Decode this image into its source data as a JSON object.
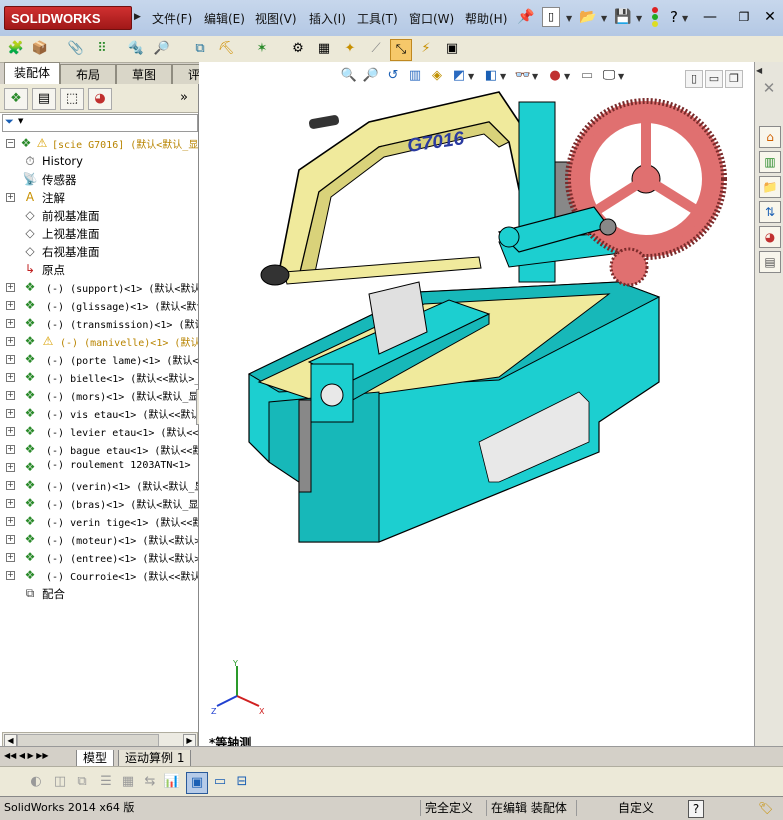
{
  "app": {
    "logo_text": "SOLIDWORKS",
    "menus": [
      "文件(F)",
      "编辑(E)",
      "视图(V)",
      "插入(I)",
      "工具(T)",
      "窗口(W)",
      "帮助(H)"
    ]
  },
  "tabs": [
    "装配体",
    "布局",
    "草图",
    "评估"
  ],
  "tree": {
    "root": "[scie G7016] (默认<默认_显",
    "items": [
      {
        "label": "History",
        "kind": "history",
        "expand": false
      },
      {
        "label": "传感器",
        "kind": "sensor",
        "expand": false
      },
      {
        "label": "注解",
        "kind": "annotation",
        "expand": true
      },
      {
        "label": "前视基准面",
        "kind": "plane",
        "expand": false
      },
      {
        "label": "上视基准面",
        "kind": "plane",
        "expand": false
      },
      {
        "label": "右视基准面",
        "kind": "plane",
        "expand": false
      },
      {
        "label": "原点",
        "kind": "origin",
        "expand": false
      },
      {
        "label": "(-) (support)<1> (默认<默认_显",
        "kind": "part",
        "expand": true
      },
      {
        "label": "(-) (glissage)<1> (默认<默认_",
        "kind": "part",
        "expand": true
      },
      {
        "label": "(-) (transmission)<1> (默认<",
        "kind": "part",
        "expand": true
      },
      {
        "label": "(-) (manivelle)<1> (默认<默",
        "kind": "part-warning",
        "expand": true
      },
      {
        "label": "(-) (porte lame)<1> (默认<默",
        "kind": "part",
        "expand": true
      },
      {
        "label": "(-) bielle<1> (默认<<默认>_显",
        "kind": "part",
        "expand": true
      },
      {
        "label": "(-) (mors)<1> (默认<默认_显",
        "kind": "part",
        "expand": true
      },
      {
        "label": "(-) vis etau<1> (默认<<默认>",
        "kind": "part",
        "expand": true
      },
      {
        "label": "(-) levier etau<1> (默认<<默",
        "kind": "part",
        "expand": true
      },
      {
        "label": "(-) bague etau<1> (默认<<默",
        "kind": "part",
        "expand": true
      },
      {
        "label": "(-) roulement 1203ATN<1>",
        "kind": "part",
        "expand": true
      },
      {
        "label": "(-) (verin)<1> (默认<默认_显",
        "kind": "part",
        "expand": true
      },
      {
        "label": "(-) (bras)<1> (默认<默认_显",
        "kind": "part",
        "expand": true
      },
      {
        "label": "(-) verin tige<1> (默认<<默",
        "kind": "part",
        "expand": true
      },
      {
        "label": "(-) (moteur)<1> (默认<默认>",
        "kind": "part",
        "expand": true
      },
      {
        "label": "(-) (entree)<1> (默认<默认>",
        "kind": "part",
        "expand": true
      },
      {
        "label": "(-) Courroie<1> (默认<<默认",
        "kind": "part",
        "expand": true
      },
      {
        "label": "配合",
        "kind": "mates",
        "expand": false
      }
    ]
  },
  "viewport": {
    "model_label": "G7016",
    "view_label": "*等轴测",
    "triad": {
      "x": "X",
      "y": "Y",
      "z": "Z"
    }
  },
  "bottom_tabs": [
    "模型",
    "运动算例 1"
  ],
  "status": {
    "version": "SolidWorks 2014 x64 版",
    "definition": "完全定义",
    "mode": "在编辑 装配体",
    "units": "自定义",
    "help": "?"
  },
  "colors": {
    "frame": "#f0ea9c",
    "base": "#1ccfd0",
    "gear": "#e07070",
    "warning": "#e8b400",
    "selection_tab": "#ffffff"
  }
}
